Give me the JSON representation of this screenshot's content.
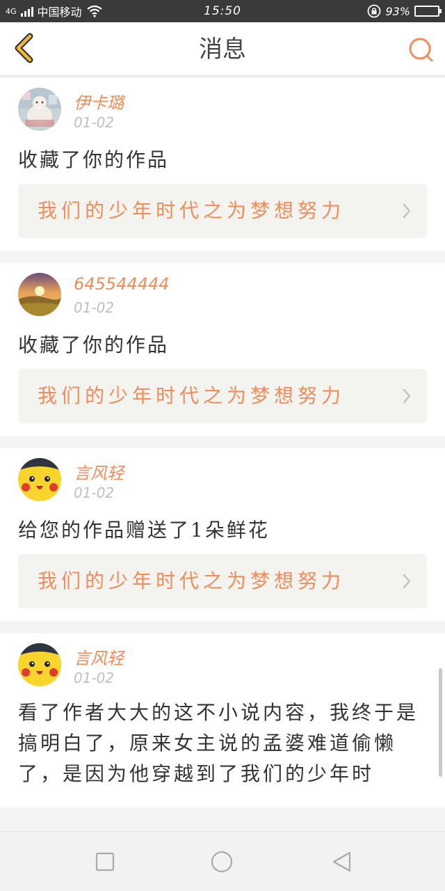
{
  "status_bar": {
    "network": "4G",
    "carrier": "中国移动",
    "time": "15:50",
    "battery_percent": "93%",
    "battery_level": 0.93,
    "icons": [
      "signal-icon",
      "wifi-icon",
      "lock-icon",
      "battery-icon"
    ]
  },
  "header": {
    "title": "消息",
    "back_icon": "chevron-left-icon",
    "search_icon": "search-icon"
  },
  "colors": {
    "accent": "#f28c5a",
    "back_icon": "#f2b830",
    "status_bar_bg": "#3a3a3a",
    "battery_fill": "#2a9df4"
  },
  "messages": [
    {
      "username": "伊卡璐",
      "date": "01-02",
      "action": "收藏了你的作品",
      "work_title": "我们的少年时代之为梦想努力",
      "avatar": "doll-avatar"
    },
    {
      "username": "645544444",
      "date": "01-02",
      "action": "收藏了你的作品",
      "work_title": "我们的少年时代之为梦想努力",
      "avatar": "sunset-avatar"
    },
    {
      "username": "言风轻",
      "date": "01-02",
      "action": "给您的作品赠送了1朵鲜花",
      "work_title": "我们的少年时代之为梦想努力",
      "avatar": "pikachu-avatar"
    },
    {
      "username": "言风轻",
      "date": "01-02",
      "comment": "看了作者大大的这不小说内容，我终于是搞明白了，原来女主说的孟婆难道偷懒了，是因为他穿越到了我们的少年时",
      "avatar": "pikachu-avatar"
    }
  ],
  "nav_buttons": [
    "recent-apps-button",
    "home-button",
    "back-button"
  ]
}
